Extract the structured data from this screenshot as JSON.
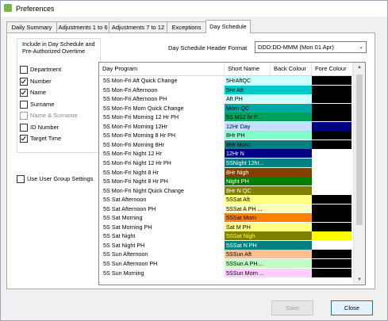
{
  "window": {
    "title": "Preferences"
  },
  "tabs": [
    "Daily Summary",
    "Adjustments 1 to 6",
    "Adjustments 7 to 12",
    "Exceptions",
    "Day Schedule"
  ],
  "active_tab": "Day Schedule",
  "include_group": {
    "title": "Include in Day Schedule and Pre-Authorized Overtime",
    "options": [
      {
        "label": "Department",
        "checked": false,
        "enabled": true
      },
      {
        "label": "Number",
        "checked": true,
        "enabled": true
      },
      {
        "label": "Name",
        "checked": true,
        "enabled": true
      },
      {
        "label": "Surname",
        "checked": false,
        "enabled": true
      },
      {
        "label": "Name & Surname",
        "checked": false,
        "enabled": false
      },
      {
        "label": "ID Number",
        "checked": false,
        "enabled": true
      },
      {
        "label": "Target Time",
        "checked": true,
        "enabled": true
      }
    ]
  },
  "use_user_group": {
    "label": "Use User Group Settings",
    "checked": false
  },
  "header_format": {
    "label": "Day Schedule Header Format",
    "value": "DDD:DD-MMM (Mon 01 Apr)"
  },
  "grid": {
    "columns": [
      "Day Program",
      "Short Name",
      "Back Colour",
      "Fore Colour"
    ],
    "rows": [
      {
        "program": "5S Mon-Fri Aft Quick Change",
        "short": "5HrAftQC",
        "back": "#ccffff",
        "fore": "#000000"
      },
      {
        "program": "5S Mon-Fri Afternoon",
        "short": "5Hr Aft",
        "back": "#00c8c8",
        "fore": "#000000"
      },
      {
        "program": "5S Mon-Fri Afternoon PH",
        "short": "Aft PH",
        "back": "#ccffff",
        "fore": "#000000"
      },
      {
        "program": "5S Mon-Fri Morn Quick Change",
        "short": "Morn QC",
        "back": "#00a8a8",
        "fore": "#000000"
      },
      {
        "program": "5S Mon-Fri Morning 12 Hr PH",
        "short": "5S M12 hr P...",
        "back": "#00a060",
        "fore": "#000000"
      },
      {
        "program": "5S Mon-Fri Morning 12Hr",
        "short": "12Hr Day",
        "back": "#c8e0ff",
        "fore": "#000080"
      },
      {
        "program": "5S Mon-Fri Morning 8 Hr PH",
        "short": "8Hr PH",
        "back": "#80ffcc",
        "fore": "#000000"
      },
      {
        "program": "5S Mon-Fri Morning 8Hr",
        "short": "8Hr Morn",
        "back": "#008080",
        "fore": "#000000"
      },
      {
        "program": "5S Mon-Fri Night 12 Hr",
        "short": "12Hr N",
        "back": "#000080",
        "fore": "#ffffff"
      },
      {
        "program": "5S Mon-Fri Night 12 Hr PH",
        "short": "5SNight 12hr...",
        "back": "#008080",
        "fore": "#ffffff"
      },
      {
        "program": "5S Mon-Fri Night 8 Hr",
        "short": "8Hr Nigh",
        "back": "#804000",
        "fore": "#ffffff"
      },
      {
        "program": "5S Mon-Fri Night 8 Hr PH",
        "short": "Night PH",
        "back": "#008000",
        "fore": "#ffffff"
      },
      {
        "program": "5S Mon-Fri Night Quick Change",
        "short": "8Hr N QC",
        "back": "#808000",
        "fore": "#ffffff"
      },
      {
        "program": "5S Sat Afternoon",
        "short": "5SSat Aft",
        "back": "#ffff80",
        "fore": "#000000"
      },
      {
        "program": "5S Sat Afternoon PH",
        "short": "5SSat A PH ...",
        "back": "#ffffc0",
        "fore": "#000000"
      },
      {
        "program": "5S Sat Morning",
        "short": "5SSat Morn",
        "back": "#ff8000",
        "fore": "#000000"
      },
      {
        "program": "5S Sat Morning PH",
        "short": "Sat M PH",
        "back": "#ffff80",
        "fore": "#000000"
      },
      {
        "program": "5S Sat Night",
        "short": "5SSat Nigh",
        "back": "#808000",
        "fore": "#ffff00"
      },
      {
        "program": "5S Sat Night PH",
        "short": "5SSat N PH",
        "back": "#008080",
        "fore": "#ffffff"
      },
      {
        "program": "5S Sun Afternoon",
        "short": "5SSun Aft",
        "back": "#ffc090",
        "fore": "#000000"
      },
      {
        "program": "5S Sun Afternoon PH",
        "short": "5SSun A PH...",
        "back": "#c0ffc0",
        "fore": "#000000"
      },
      {
        "program": "5S Sun Morning",
        "short": "5SSun Morn ...",
        "back": "#ffd0ff",
        "fore": "#000000"
      }
    ]
  },
  "buttons": {
    "save": "Save",
    "close": "Close"
  },
  "colors": {
    "accent": "#0078d7",
    "panel_border": "#ababab"
  }
}
